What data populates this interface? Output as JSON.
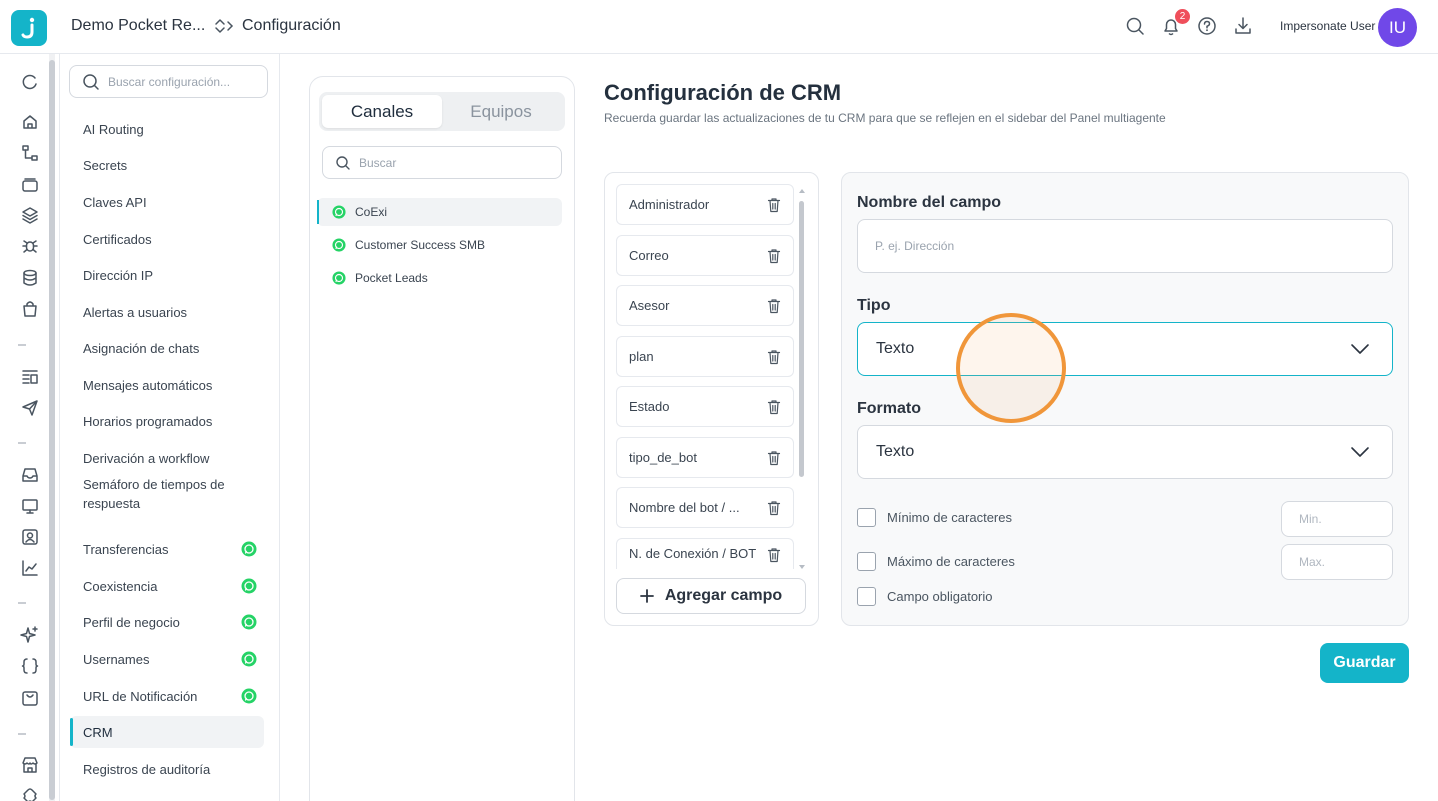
{
  "header": {
    "workspace": "Demo Pocket Re...",
    "breadcrumb_current": "Configuración",
    "notification_count": "2",
    "user_name": "Impersonate User",
    "avatar_initials": "IU"
  },
  "settings_nav": {
    "search_placeholder": "Buscar configuración...",
    "items": [
      {
        "label": "AI Routing"
      },
      {
        "label": "Secrets"
      },
      {
        "label": "Claves API"
      },
      {
        "label": "Certificados"
      },
      {
        "label": "Dirección IP"
      },
      {
        "label": "Alertas a usuarios"
      },
      {
        "label": "Asignación de chats"
      },
      {
        "label": "Mensajes automáticos"
      },
      {
        "label": "Horarios programados"
      },
      {
        "label": "Derivación a workflow"
      },
      {
        "label": "Semáforo de tiempos de respuesta"
      },
      {
        "label": "Transferencias",
        "whatsapp": true
      },
      {
        "label": "Coexistencia",
        "whatsapp": true
      },
      {
        "label": "Perfil de negocio",
        "whatsapp": true
      },
      {
        "label": "Usernames",
        "whatsapp": true
      },
      {
        "label": "URL de Notificación",
        "whatsapp": true
      },
      {
        "label": "CRM",
        "active": true
      },
      {
        "label": "Registros de auditoría"
      }
    ]
  },
  "channels": {
    "tabs": [
      "Canales",
      "Equipos"
    ],
    "active_tab": "Canales",
    "search_placeholder": "Buscar",
    "items": [
      "CoExi",
      "Customer Success SMB",
      "Pocket Leads"
    ],
    "active_item": "CoExi"
  },
  "page": {
    "title": "Configuración de CRM",
    "subtitle": "Recuerda guardar las actualizaciones de tu CRM para que se reflejen en el sidebar del Panel multiagente"
  },
  "fields": {
    "items": [
      "Administrador",
      "Correo",
      "Asesor",
      "plan",
      "Estado",
      "tipo_de_bot",
      "Nombre del bot / ...",
      "N. de Conexión / BOT"
    ],
    "add_label": "Agregar campo"
  },
  "form": {
    "name_label": "Nombre del campo",
    "name_placeholder": "P. ej. Dirección",
    "name_value": "",
    "type_label": "Tipo",
    "type_value": "Texto",
    "format_label": "Formato",
    "format_value": "Texto",
    "min_chars_label": "Mínimo de caracteres",
    "min_placeholder": "Min.",
    "max_chars_label": "Máximo de caracteres",
    "max_placeholder": "Max.",
    "required_label": "Campo obligatorio",
    "min_checked": false,
    "max_checked": false,
    "required_checked": false
  },
  "actions": {
    "save_label": "Guardar"
  },
  "colors": {
    "accent": "#14b4c9",
    "avatar": "#7048e8",
    "badge": "#ef4f5b",
    "whatsapp": "#25d366",
    "click_indicator": "#f0963a"
  },
  "rail_icons": [
    "refresh-icon",
    "home-icon",
    "flow-icon",
    "folder-icon",
    "layers-icon",
    "bug-icon",
    "database-icon",
    "bag-icon",
    "list-icon",
    "send-icon",
    "inbox-icon",
    "monitor-icon",
    "contact-icon",
    "chart-icon",
    "sparkles-icon",
    "code-braces-icon",
    "shopping-bag-icon",
    "store-icon",
    "puzzle-icon"
  ]
}
